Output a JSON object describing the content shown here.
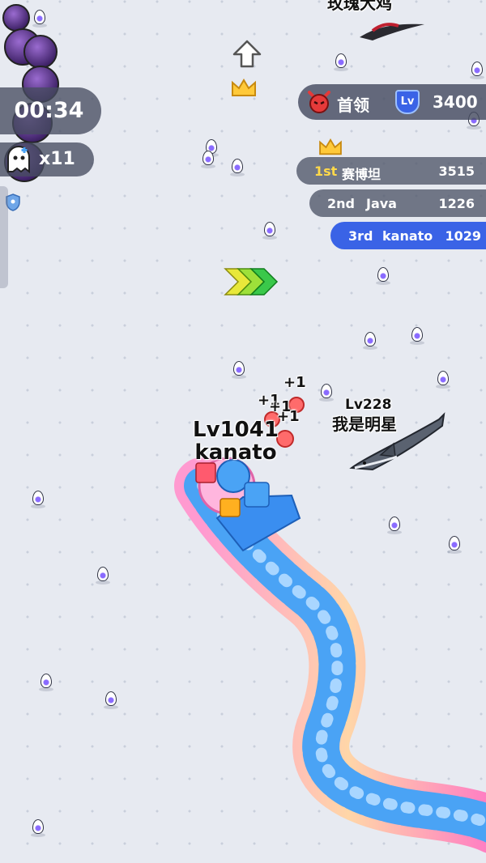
{
  "hud": {
    "timer": "00:34",
    "lives_count": "x11"
  },
  "boss": {
    "label": "首领",
    "level_badge": "Lv",
    "score": "3400"
  },
  "leaderboard": [
    {
      "rank": "1st",
      "name": "赛博坦",
      "score": "3515"
    },
    {
      "rank": "2nd",
      "name": "Java",
      "score": "1226"
    },
    {
      "rank": "3rd",
      "name": "kanato",
      "score": "1029"
    }
  ],
  "player": {
    "level": "Lv1041",
    "name": "kanato"
  },
  "enemy_shark": {
    "level": "Lv228",
    "name": "我是明星"
  },
  "enemy_top": {
    "name": "玫瑰大鸡"
  },
  "popups": [
    "+1",
    "+1",
    "+1",
    "+1"
  ],
  "colors": {
    "my_row": "#3a63e6",
    "hud_panel": "#464c60",
    "gold": "#ffd94a",
    "snake_blue": "#4aa3f5",
    "egg_purple": "#8a6bff"
  }
}
